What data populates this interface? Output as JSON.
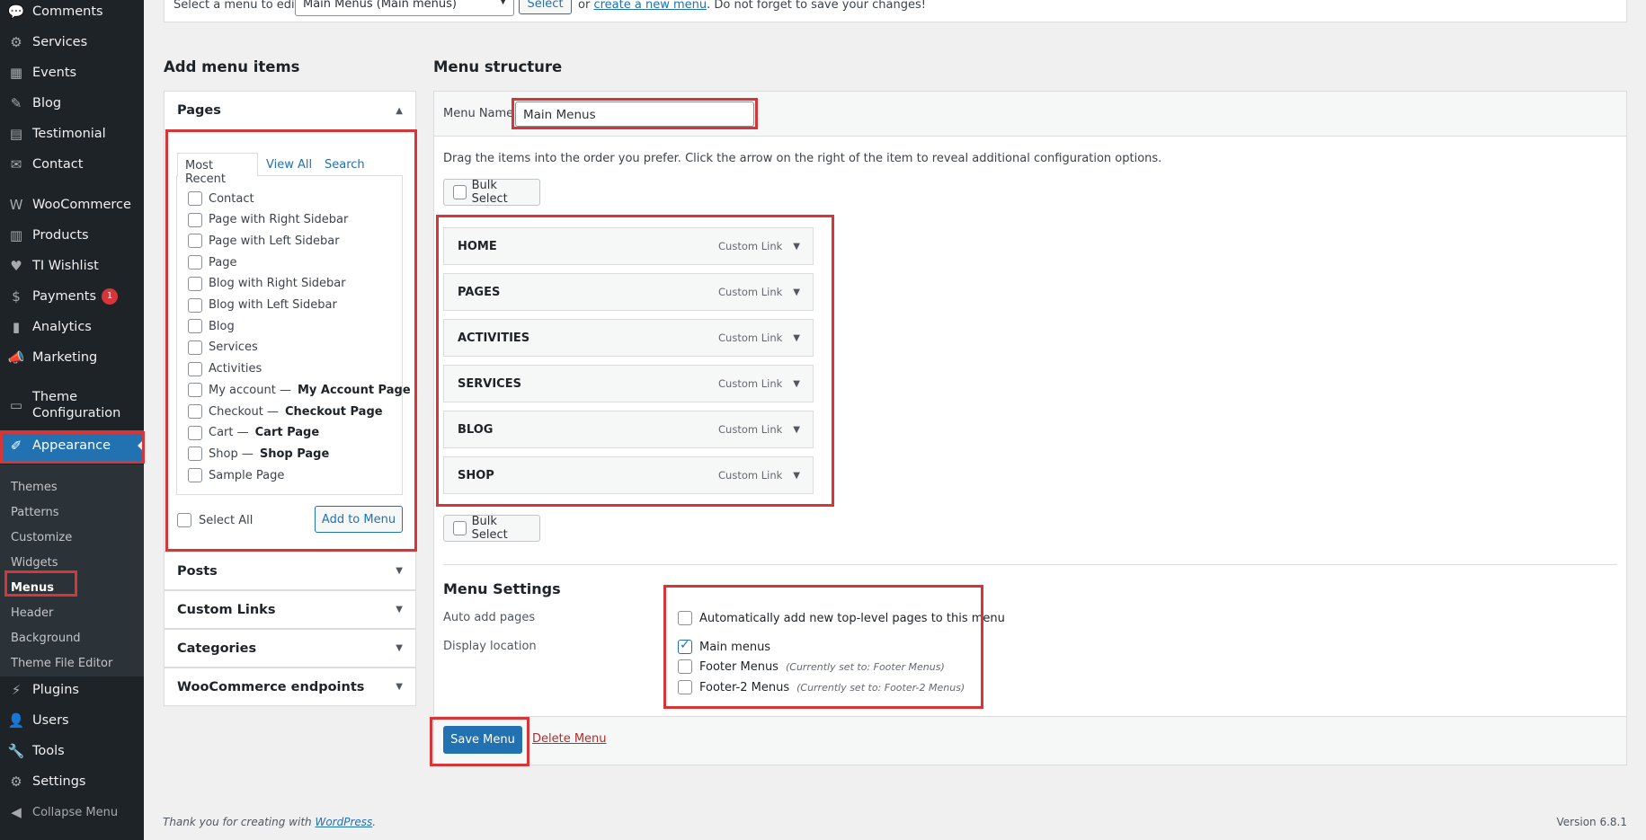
{
  "sidebar": {
    "items": [
      {
        "icon": "comment-icon",
        "glyph": "💬",
        "label": "Comments"
      },
      {
        "icon": "gear-icon",
        "glyph": "⚙",
        "label": "Services"
      },
      {
        "icon": "events-icon",
        "glyph": "▦",
        "label": "Events"
      },
      {
        "icon": "blog-icon",
        "glyph": "✎",
        "label": "Blog"
      },
      {
        "icon": "testimonial-icon",
        "glyph": "▤",
        "label": "Testimonial"
      },
      {
        "icon": "mail-icon",
        "glyph": "✉",
        "label": "Contact"
      },
      {
        "icon": "woocommerce-icon",
        "glyph": "W",
        "label": "WooCommerce"
      },
      {
        "icon": "products-icon",
        "glyph": "▥",
        "label": "Products"
      },
      {
        "icon": "wishlist-icon",
        "glyph": "♥",
        "label": "TI Wishlist"
      },
      {
        "icon": "payments-icon",
        "glyph": "$",
        "label": "Payments",
        "badge": "1"
      },
      {
        "icon": "analytics-icon",
        "glyph": "▮",
        "label": "Analytics"
      },
      {
        "icon": "marketing-icon",
        "glyph": "📣",
        "label": "Marketing"
      },
      {
        "icon": "theme-config-icon",
        "glyph": "▭",
        "label": "Theme",
        "label2": "Configuration"
      },
      {
        "icon": "appearance-icon",
        "glyph": "✐",
        "label": "Appearance"
      },
      {
        "icon": "plugins-icon",
        "glyph": "⚡",
        "label": "Plugins"
      },
      {
        "icon": "users-icon",
        "glyph": "👤",
        "label": "Users"
      },
      {
        "icon": "tools-icon",
        "glyph": "🔧",
        "label": "Tools"
      },
      {
        "icon": "settings-icon",
        "glyph": "⚙",
        "label": "Settings"
      },
      {
        "icon": "collapse-icon",
        "glyph": "◀",
        "label": "Collapse Menu"
      }
    ],
    "submenu": [
      "Themes",
      "Patterns",
      "Customize",
      "Widgets",
      "Menus",
      "Header",
      "Background",
      "Theme File Editor"
    ]
  },
  "top": {
    "prefix": "Select a menu to edit:",
    "select_value": "Main Menus (Main menus)",
    "select_button": "Select",
    "or_text": "or",
    "create_link": "create a new menu",
    "suffix": ". Do not forget to save your changes!"
  },
  "add_items": {
    "heading": "Add menu items",
    "pages_title": "Pages",
    "tabs": [
      "Most Recent",
      "View All",
      "Search"
    ],
    "pages": [
      {
        "label": "Contact"
      },
      {
        "label": "Page with Right Sidebar"
      },
      {
        "label": "Page with Left Sidebar"
      },
      {
        "label": "Page"
      },
      {
        "label": "Blog with Right Sidebar"
      },
      {
        "label": "Blog with Left Sidebar"
      },
      {
        "label": "Blog"
      },
      {
        "label": "Services"
      },
      {
        "label": "Activities"
      },
      {
        "label": "My account —",
        "state": "My Account Page"
      },
      {
        "label": "Checkout —",
        "state": "Checkout Page"
      },
      {
        "label": "Cart —",
        "state": "Cart Page"
      },
      {
        "label": "Shop —",
        "state": "Shop Page"
      },
      {
        "label": "Sample Page"
      }
    ],
    "select_all": "Select All",
    "add_to_menu": "Add to Menu",
    "sections": [
      "Posts",
      "Custom Links",
      "Categories",
      "WooCommerce endpoints"
    ]
  },
  "structure": {
    "heading": "Menu structure",
    "menu_name_label": "Menu Name",
    "menu_name_value": "Main Menus",
    "instructions": "Drag the items into the order you prefer. Click the arrow on the right of the item to reveal additional configuration options.",
    "bulk_select": "Bulk Select",
    "items": [
      {
        "title": "HOME",
        "type": "Custom Link"
      },
      {
        "title": "PAGES",
        "type": "Custom Link"
      },
      {
        "title": "ACTIVITIES",
        "type": "Custom Link"
      },
      {
        "title": "SERVICES",
        "type": "Custom Link"
      },
      {
        "title": "BLOG",
        "type": "Custom Link"
      },
      {
        "title": "SHOP",
        "type": "Custom Link"
      }
    ],
    "settings_heading": "Menu Settings",
    "auto_add_label": "Auto add pages",
    "auto_add_text": "Automatically add new top-level pages to this menu",
    "display_location_label": "Display location",
    "locations": [
      {
        "name": "Main menus",
        "note": "",
        "checked": true
      },
      {
        "name": "Footer Menus",
        "note": "(Currently set to: Footer Menus)",
        "checked": false
      },
      {
        "name": "Footer-2 Menus",
        "note": "(Currently set to: Footer-2 Menus)",
        "checked": false
      }
    ],
    "save_menu": "Save Menu",
    "delete_menu": "Delete Menu"
  },
  "footer": {
    "thanks_prefix": "Thank you for creating with",
    "wordpress_link": "WordPress",
    "thanks_suffix": ".",
    "version": "Version 6.8.1"
  },
  "colors": {
    "accent": "#2271b1",
    "sidebar_bg": "#1d2327",
    "highlight_box": "#d63638",
    "delete_link": "#b32d2e"
  }
}
